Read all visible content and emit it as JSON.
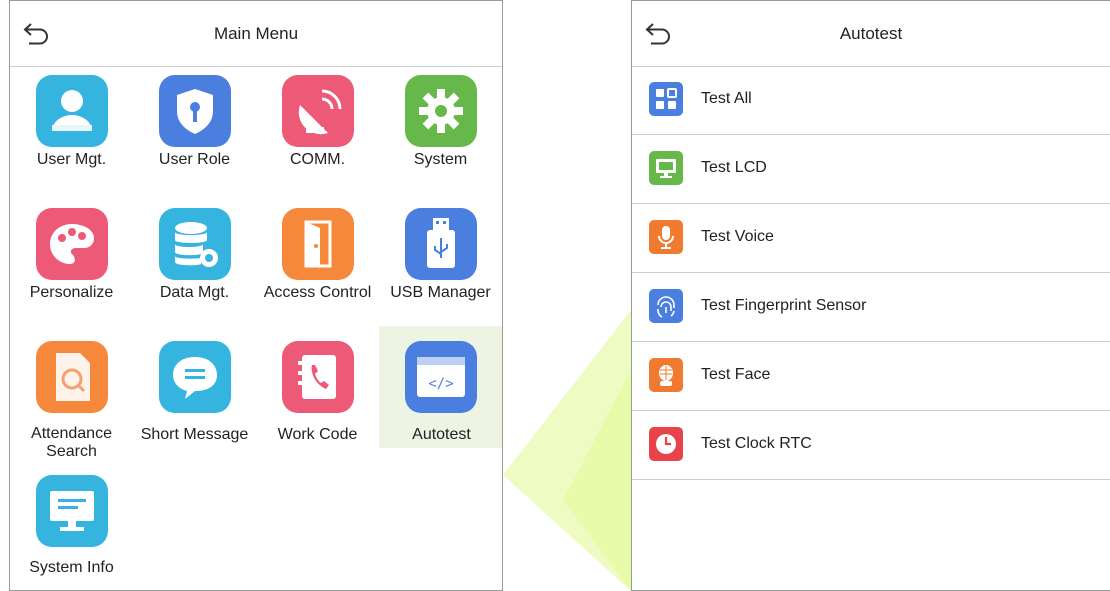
{
  "main_menu": {
    "title": "Main Menu",
    "items": [
      {
        "label": "User Mgt.",
        "icon": "user-icon",
        "color": "#36b4e0"
      },
      {
        "label": "User Role",
        "icon": "shield-key-icon",
        "color": "#4a7fe0"
      },
      {
        "label": "COMM.",
        "icon": "satellite-dish-icon",
        "color": "#ec5a78"
      },
      {
        "label": "System",
        "icon": "gear-icon",
        "color": "#66b84a"
      },
      {
        "label": "Personalize",
        "icon": "palette-icon",
        "color": "#ec5a78"
      },
      {
        "label": "Data Mgt.",
        "icon": "database-gear-icon",
        "color": "#36b4e0"
      },
      {
        "label": "Access Control",
        "icon": "door-icon",
        "color": "#f5883a"
      },
      {
        "label": "USB Manager",
        "icon": "usb-icon",
        "color": "#4a7fe0"
      },
      {
        "label": "Attendance Search",
        "label_line1": "Attendance",
        "label_line2": "Search",
        "icon": "document-search-icon",
        "color": "#f5883a"
      },
      {
        "label": "Short Message",
        "icon": "chat-bubble-icon",
        "color": "#36b4e0"
      },
      {
        "label": "Work Code",
        "icon": "phone-book-icon",
        "color": "#ec5a78"
      },
      {
        "label": "Autotest",
        "icon": "code-window-icon",
        "color": "#4a7fe0",
        "selected": true
      },
      {
        "label": "System Info",
        "icon": "monitor-icon",
        "color": "#36b4e0"
      }
    ]
  },
  "autotest": {
    "title": "Autotest",
    "items": [
      {
        "label": "Test All",
        "icon": "grid-icon",
        "color": "#4a7fe0"
      },
      {
        "label": "Test LCD",
        "icon": "monitor-icon",
        "color": "#66b84a"
      },
      {
        "label": "Test Voice",
        "icon": "microphone-icon",
        "color": "#f07a30"
      },
      {
        "label": "Test Fingerprint Sensor",
        "icon": "fingerprint-icon",
        "color": "#4a7fe0"
      },
      {
        "label": "Test Face",
        "icon": "face-icon",
        "color": "#f07a30"
      },
      {
        "label": "Test Clock RTC",
        "icon": "clock-icon",
        "color": "#e8424a"
      }
    ]
  },
  "watermark_color": "#c8f03c"
}
